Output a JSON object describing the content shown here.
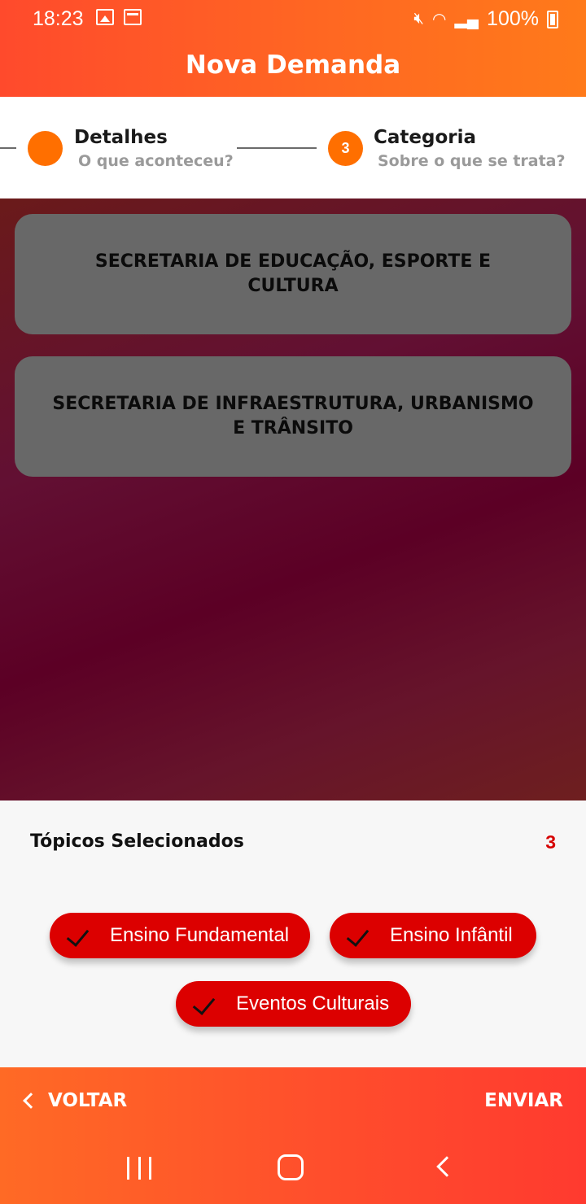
{
  "status_bar": {
    "time": "18:23",
    "battery": "100%",
    "icons": [
      "gallery-icon",
      "calendar-icon",
      "mute-icon",
      "wifi-icon",
      "signal-icon",
      "battery-charging-icon"
    ]
  },
  "header": {
    "title": "Nova Demanda"
  },
  "stepper": {
    "steps": [
      {
        "title": "Detalhes",
        "subtitle": "O que aconteceu?",
        "number": ""
      },
      {
        "title": "Categoria",
        "subtitle": "Sobre o que se trata?",
        "number": "3"
      }
    ]
  },
  "categories": [
    {
      "label": "SECRETARIA DE EDUCAÇÃO, ESPORTE E CULTURA"
    },
    {
      "label": "SECRETARIA DE INFRAESTRUTURA, URBANISMO E TRÂNSITO"
    }
  ],
  "topics": {
    "title": "Tópicos Selecionados",
    "count": "3",
    "chips": [
      {
        "label": "Ensino Fundamental"
      },
      {
        "label": "Ensino Infântil"
      },
      {
        "label": "Eventos Culturais"
      }
    ]
  },
  "footer": {
    "back_label": "VOLTAR",
    "send_label": "ENVIAR"
  },
  "colors": {
    "accent_orange": "#ff6f00",
    "chip_red": "#dc0000",
    "count_red": "#d60000",
    "card_gray": "#686868",
    "background_maroon": "#5c0025"
  }
}
